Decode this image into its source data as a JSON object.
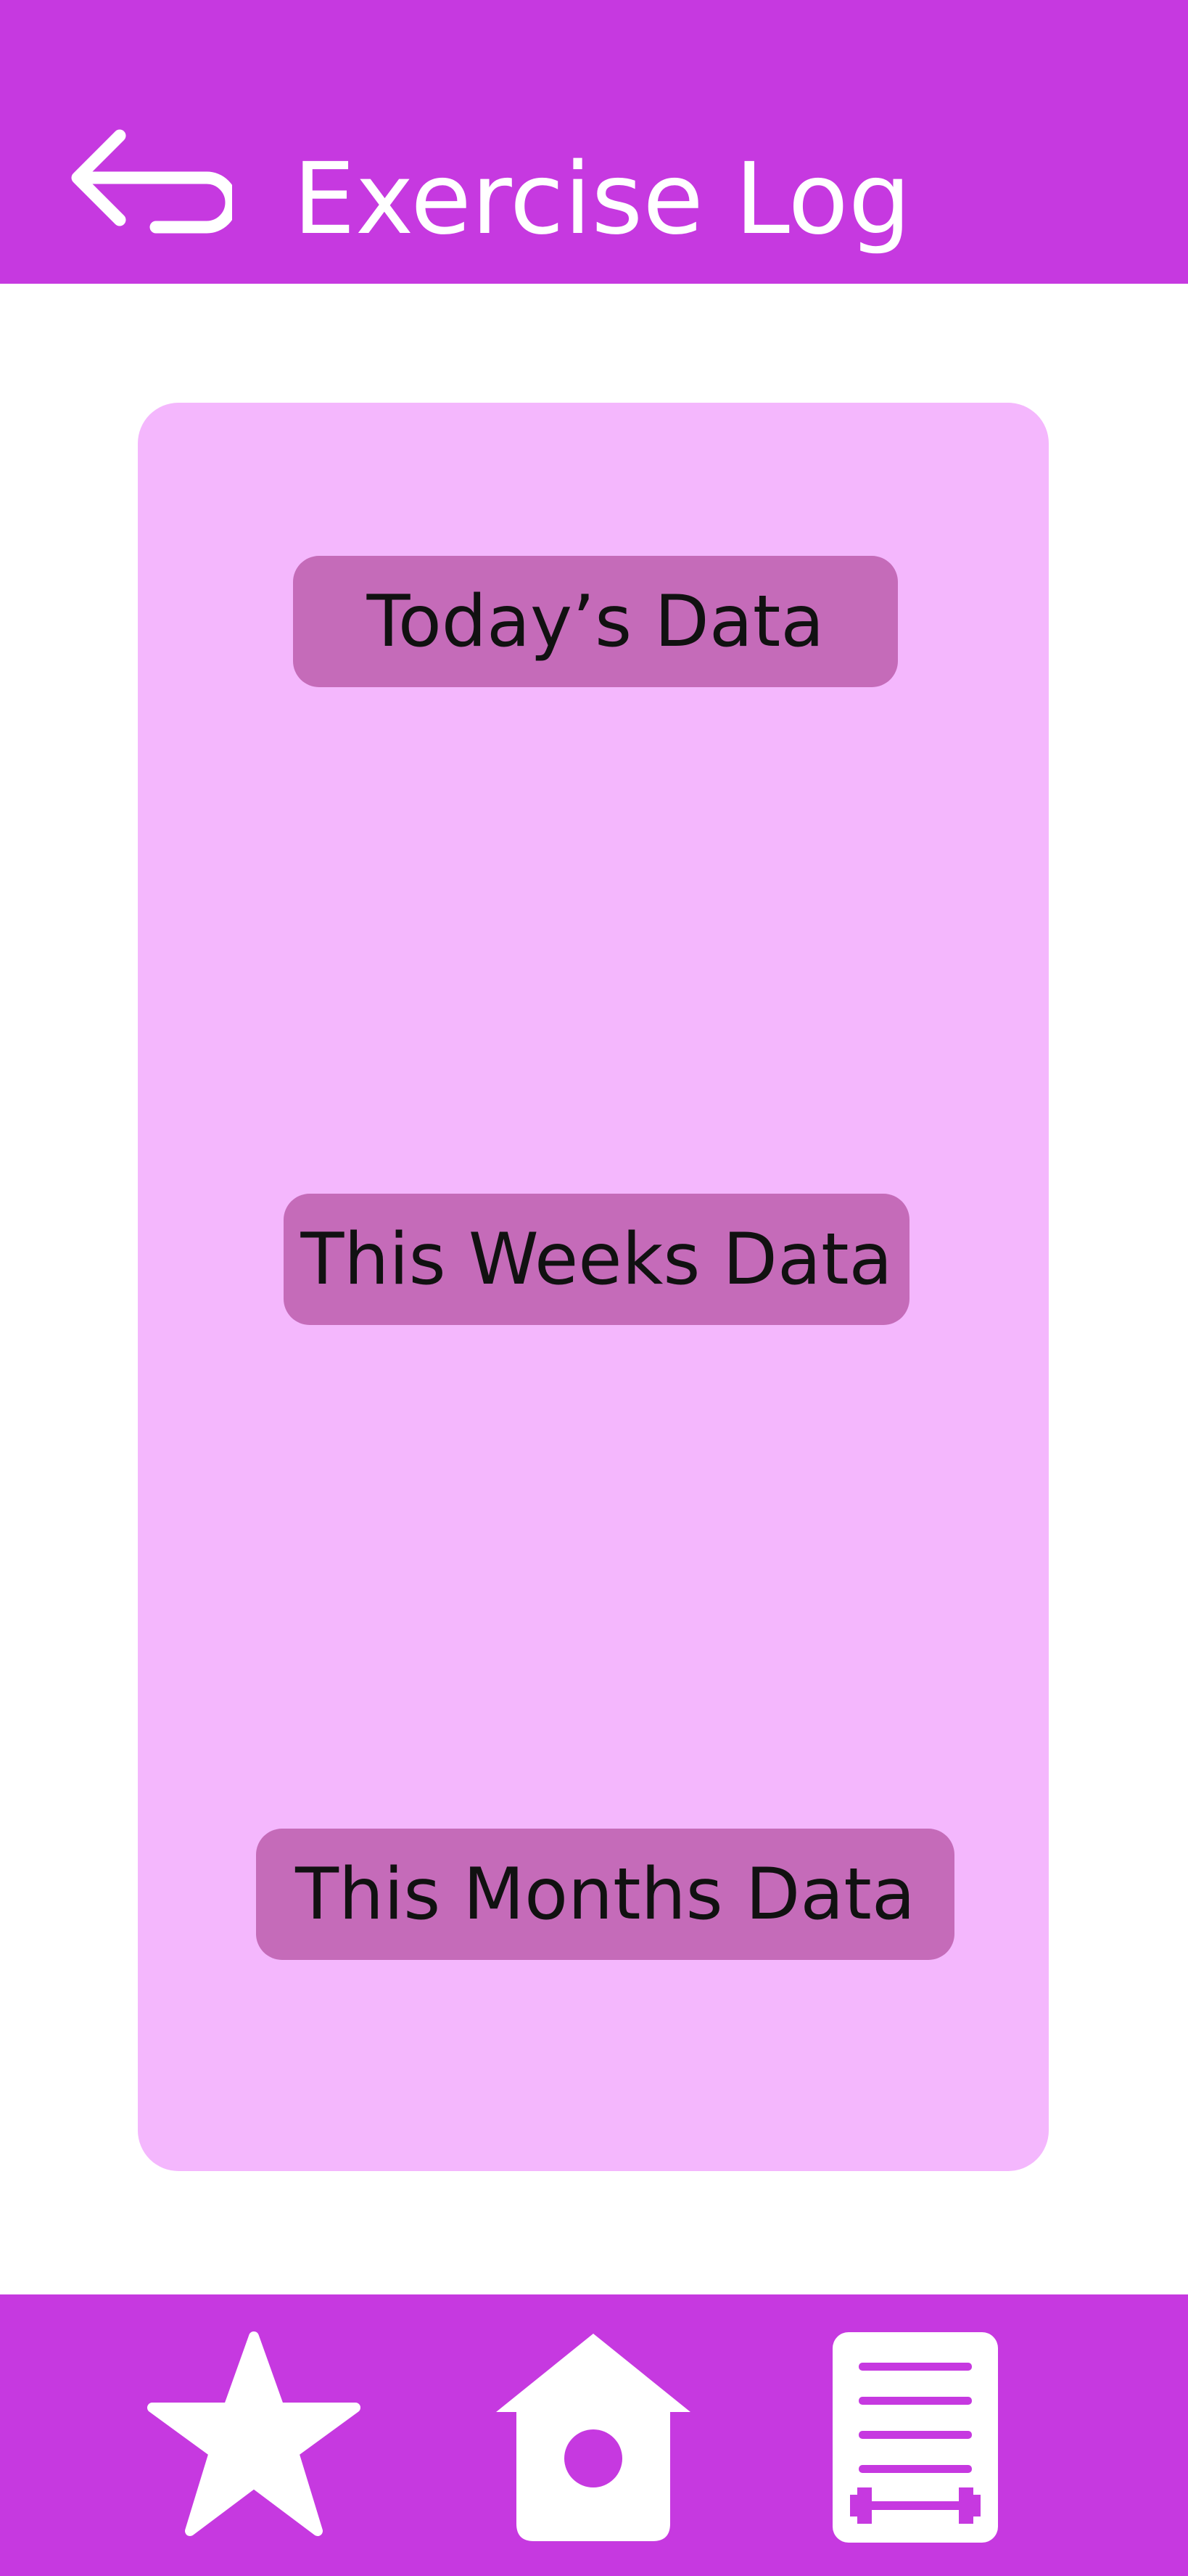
{
  "header": {
    "title": "Exercise Log",
    "back_icon": "back-arrow-icon"
  },
  "panel": {
    "buttons": [
      {
        "label": "Today’s Data"
      },
      {
        "label": "This Weeks Data"
      },
      {
        "label": "This Months Data"
      }
    ]
  },
  "bottom_nav": {
    "items": [
      {
        "icon": "star-icon"
      },
      {
        "icon": "home-icon"
      },
      {
        "icon": "workout-log-icon"
      }
    ]
  },
  "colors": {
    "primary": "#c639e0",
    "panel": "#f4b7fd",
    "button": "#c56bb9",
    "button_text": "#111111",
    "header_text": "#ffffff"
  }
}
